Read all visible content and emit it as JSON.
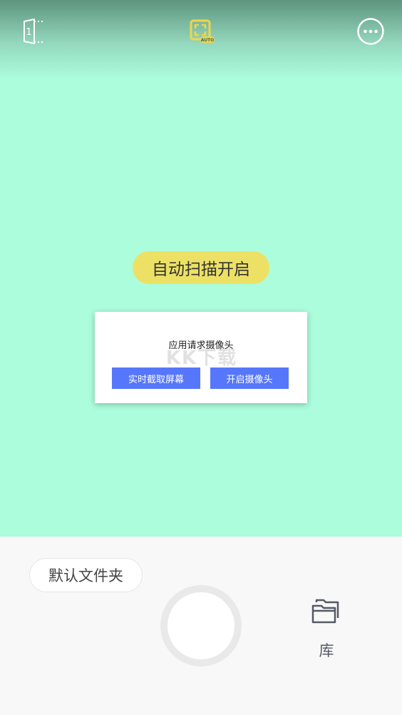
{
  "top_bar": {
    "page_count": "1",
    "auto_icon_label": "AUTO",
    "icons": [
      "page-count-icon",
      "auto-scan-icon",
      "more-options-icon"
    ]
  },
  "scanner": {
    "auto_scan_status": "自动扫描开启"
  },
  "permission_dialog": {
    "message": "应用请求摄像头",
    "screen_capture_button": "实时截取屏幕",
    "open_camera_button": "开启摄像头"
  },
  "bottom_bar": {
    "folder_label": "默认文件夹",
    "library_label": "库",
    "icons": [
      "shutter-button",
      "folder-stack-icon"
    ]
  },
  "colors": {
    "viewfinder_bg": "#abfddc",
    "auto_pill": "#ece165",
    "auto_icon": "#f2d54a",
    "dialog_button": "#5677fc",
    "bottom_bar_bg": "#f8f8f8"
  }
}
